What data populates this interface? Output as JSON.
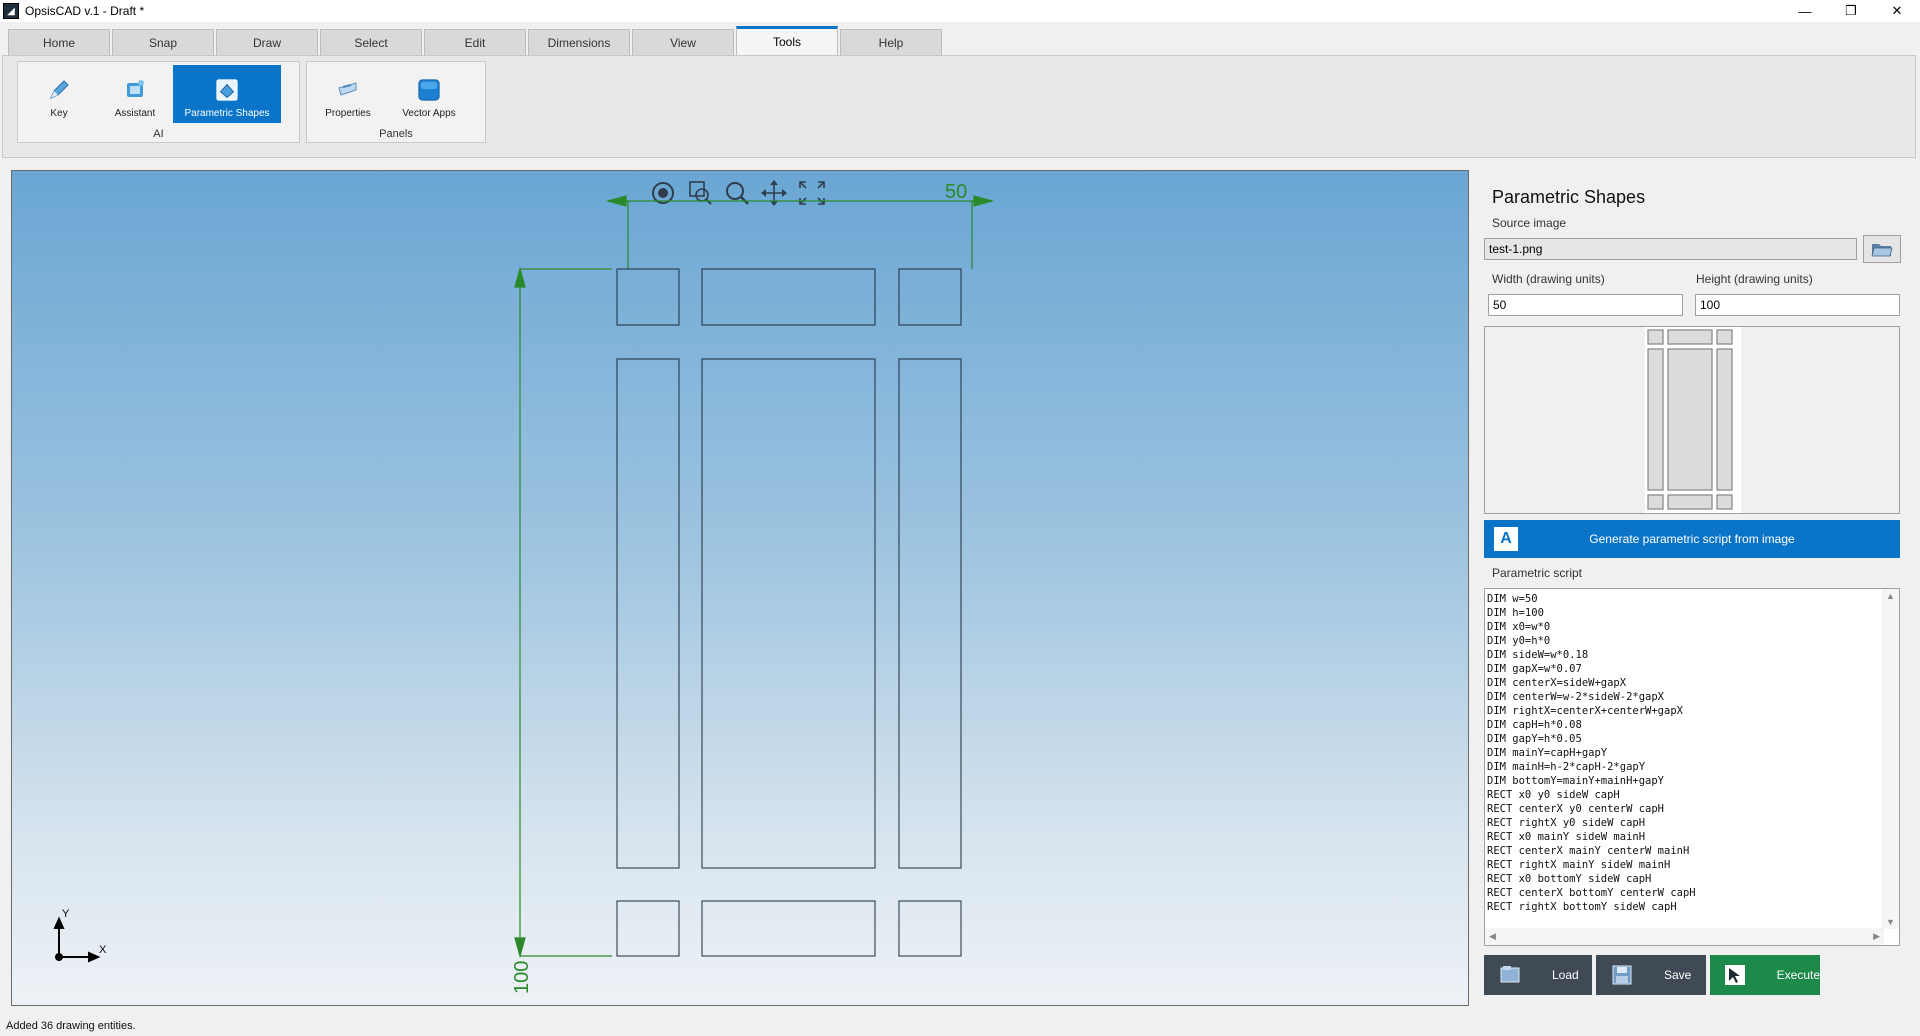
{
  "window": {
    "title": "OpsisCAD v.1 - Draft *",
    "app_icon": "opsiscad-logo-icon",
    "controls": {
      "minimize": "—",
      "restore": "❐",
      "close": "✕"
    }
  },
  "tabs": [
    {
      "label": "Home",
      "active": false
    },
    {
      "label": "Snap",
      "active": false
    },
    {
      "label": "Draw",
      "active": false
    },
    {
      "label": "Select",
      "active": false
    },
    {
      "label": "Edit",
      "active": false
    },
    {
      "label": "Dimensions",
      "active": false
    },
    {
      "label": "View",
      "active": false
    },
    {
      "label": "Tools",
      "active": true
    },
    {
      "label": "Help",
      "active": false
    }
  ],
  "ribbon": {
    "ai_group": {
      "label": "AI",
      "buttons": [
        {
          "label": "Key",
          "icon": "key-pen-icon",
          "active": false
        },
        {
          "label": "Assistant",
          "icon": "assistant-icon",
          "active": false
        },
        {
          "label": "Parametric Shapes",
          "icon": "parametric-shapes-icon",
          "active": true
        }
      ]
    },
    "panels_group": {
      "label": "Panels",
      "buttons": [
        {
          "label": "Properties",
          "icon": "properties-icon",
          "active": false
        },
        {
          "label": "Vector Apps",
          "icon": "vector-apps-icon",
          "active": false
        }
      ]
    }
  },
  "canvas": {
    "toolbar_icons": [
      "orbit-icon",
      "zoom-window-icon",
      "zoom-icon",
      "pan-icon",
      "zoom-extents-icon"
    ],
    "dimension_width": "50",
    "dimension_height": "100",
    "axis_y_label": "Y",
    "axis_x_label": "X",
    "drawing_color": "#2a8a2a",
    "background_top": "#6aa6d4",
    "background_bottom": "#eef2f6"
  },
  "panel": {
    "title": "Parametric Shapes",
    "source_label": "Source image",
    "source_value": "test-1.png",
    "browse_icon": "open-folder-icon",
    "width_label": "Width (drawing units)",
    "width_value": "50",
    "height_label": "Height (drawing units)",
    "height_value": "100",
    "generate_label": "Generate parametric script from image",
    "generate_icon": "ai-logo-icon",
    "script_label": "Parametric script",
    "script": "DIM w=50\nDIM h=100\nDIM x0=w*0\nDIM y0=h*0\nDIM sideW=w*0.18\nDIM gapX=w*0.07\nDIM centerX=sideW+gapX\nDIM centerW=w-2*sideW-2*gapX\nDIM rightX=centerX+centerW+gapX\nDIM capH=h*0.08\nDIM gapY=h*0.05\nDIM mainY=capH+gapY\nDIM mainH=h-2*capH-2*gapY\nDIM bottomY=mainY+mainH+gapY\nRECT x0 y0 sideW capH\nRECT centerX y0 centerW capH\nRECT rightX y0 sideW capH\nRECT x0 mainY sideW mainH\nRECT centerX mainY centerW mainH\nRECT rightX mainY sideW mainH\nRECT x0 bottomY sideW capH\nRECT centerX bottomY centerW capH\nRECT rightX bottomY sideW capH",
    "buttons": {
      "load": {
        "label": "Load",
        "color": "#404a55",
        "icon": "load-icon"
      },
      "save": {
        "label": "Save",
        "color": "#404a55",
        "icon": "save-disk-icon"
      },
      "execute": {
        "label": "Execute",
        "color": "#1e8a4a",
        "icon": "cursor-arrow-icon"
      }
    }
  },
  "status": {
    "text": "Added 36 drawing entities."
  },
  "colors": {
    "accent": "#0a74c9",
    "ribbon_bg": "#e8e8e8"
  }
}
